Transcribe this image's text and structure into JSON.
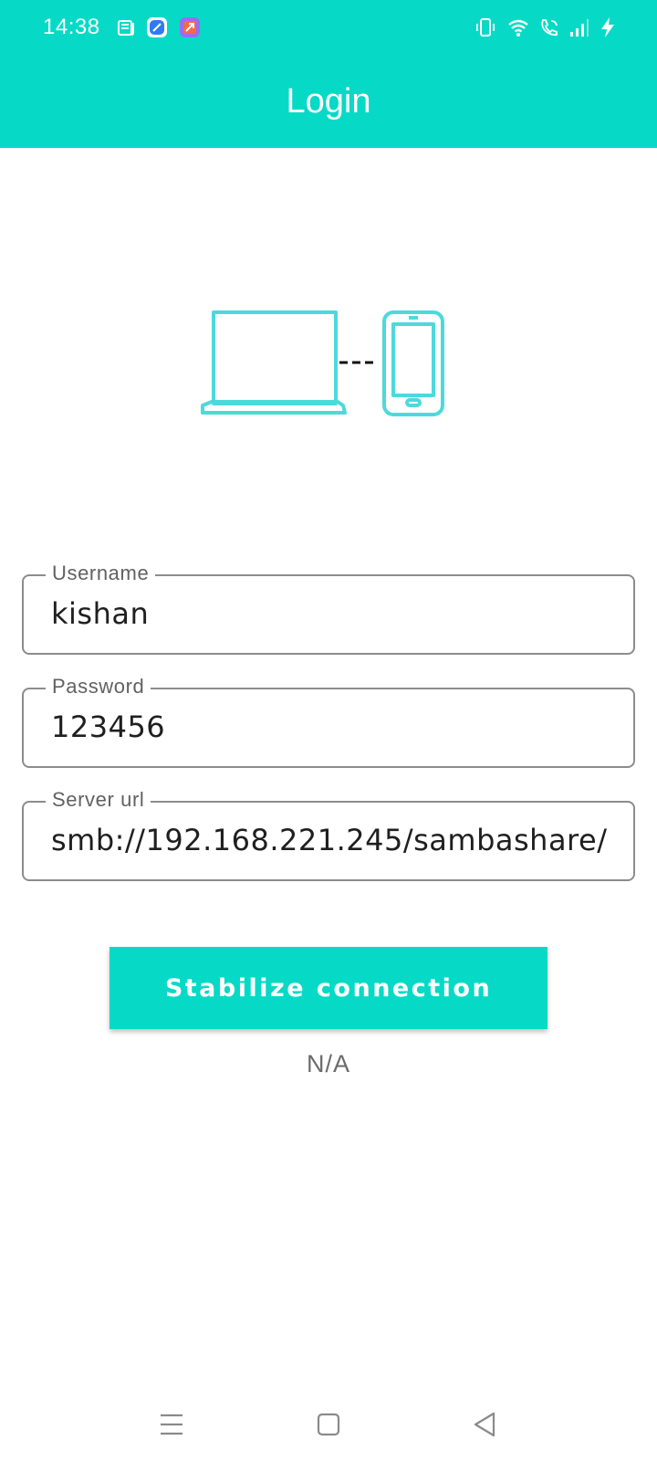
{
  "status_bar": {
    "time": "14:38"
  },
  "header": {
    "title": "Login"
  },
  "form": {
    "username": {
      "label": "Username",
      "value": "kishan"
    },
    "password": {
      "label": "Password",
      "value": "123456"
    },
    "server_url": {
      "label": "Server url",
      "value": "smb://192.168.221.245/sambashare/"
    }
  },
  "actions": {
    "connect_label": "Stabilize connection"
  },
  "connection_status": "N/A",
  "icons": {
    "hero": "laptop-phone-link-icon",
    "notifications": [
      "news-icon",
      "browser-app-icon",
      "app-shortcut-icon"
    ],
    "system": [
      "vibrate-icon",
      "wifi-icon",
      "wifi-calling-icon",
      "signal-icon",
      "charging-icon"
    ],
    "nav": [
      "menu-icon",
      "home-icon",
      "back-icon"
    ]
  },
  "colors": {
    "accent": "#06DAC6",
    "illustration": "#4DD9DC"
  }
}
